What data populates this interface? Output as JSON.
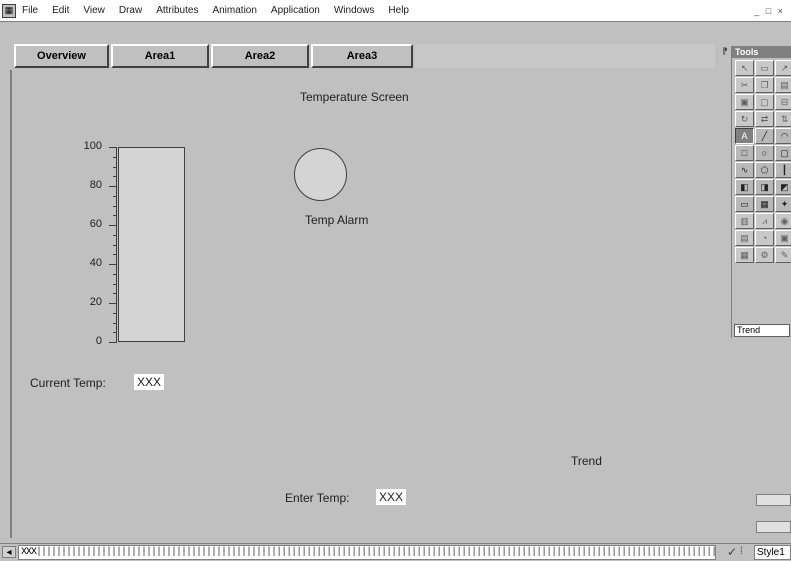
{
  "menubar": {
    "items": [
      "File",
      "Edit",
      "View",
      "Draw",
      "Attributes",
      "Animation",
      "Application",
      "Windows",
      "Help"
    ],
    "window_controls": "_ □ ×"
  },
  "tabs": [
    {
      "label": "Overview"
    },
    {
      "label": "Area1"
    },
    {
      "label": "Area2"
    },
    {
      "label": "Area3"
    }
  ],
  "screen": {
    "title": "Temperature Screen",
    "gauge_ticks": [
      "100",
      "80",
      "60",
      "40",
      "20",
      "0"
    ],
    "alarm_label": "Temp Alarm",
    "current_temp_label": "Current Temp:",
    "current_temp_value": "XXX",
    "trend_label": "Trend",
    "enter_temp_label": "Enter Temp:",
    "enter_temp_value": "XXX"
  },
  "tools_palette": {
    "title": "Tools",
    "field_value": "Trend"
  },
  "bottom_bar": {
    "input_value": "XXX",
    "style_value": "Style1"
  },
  "colors": {
    "background": "#c0c0c0",
    "value_box": "#ffffff",
    "palette_title": "#808080"
  }
}
